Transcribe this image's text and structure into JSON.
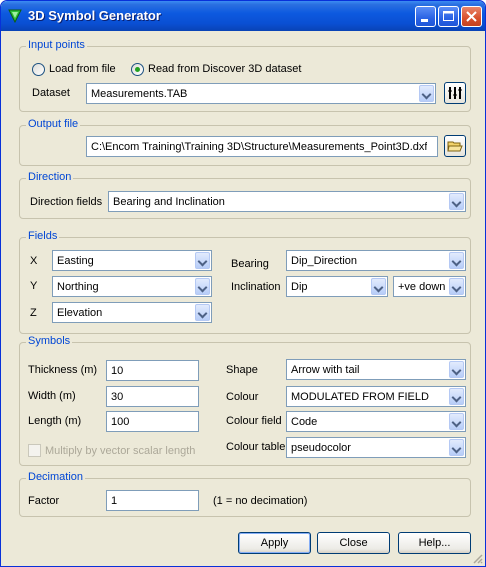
{
  "window": {
    "title": "3D Symbol Generator"
  },
  "input_points": {
    "legend": "Input points",
    "radio_file": "Load from file",
    "radio_discover": "Read from Discover 3D dataset",
    "selected": "discover",
    "dataset_label": "Dataset",
    "dataset_value": "Measurements.TAB"
  },
  "output_file": {
    "legend": "Output file",
    "path": "C:\\Encom Training\\Training 3D\\Structure\\Measurements_Point3D.dxf"
  },
  "direction": {
    "legend": "Direction",
    "fields_label": "Direction fields",
    "fields_value": "Bearing and Inclination"
  },
  "fields": {
    "legend": "Fields",
    "x_label": "X",
    "x_value": "Easting",
    "y_label": "Y",
    "y_value": "Northing",
    "z_label": "Z",
    "z_value": "Elevation",
    "bearing_label": "Bearing",
    "bearing_value": "Dip_Direction",
    "inclination_label": "Inclination",
    "inclination_value": "Dip",
    "inclination_sign": "+ve down"
  },
  "symbols": {
    "legend": "Symbols",
    "thickness_label": "Thickness (m)",
    "thickness_value": "10",
    "width_label": "Width (m)",
    "width_value": "30",
    "length_label": "Length (m)",
    "length_value": "100",
    "multiply_label": "Multiply by vector scalar length",
    "shape_label": "Shape",
    "shape_value": "Arrow with tail",
    "colour_label": "Colour",
    "colour_value": "MODULATED FROM FIELD",
    "colour_field_label": "Colour field",
    "colour_field_value": "Code",
    "colour_table_label": "Colour table",
    "colour_table_value": "pseudocolor"
  },
  "decimation": {
    "legend": "Decimation",
    "factor_label": "Factor",
    "factor_value": "1",
    "hint": "(1 = no decimation)"
  },
  "buttons": {
    "apply": "Apply",
    "close": "Close",
    "help": "Help..."
  },
  "colors": {
    "legend_blue": "#0046d5",
    "title_bar": "#0a4fd3",
    "face": "#ece9d8"
  }
}
